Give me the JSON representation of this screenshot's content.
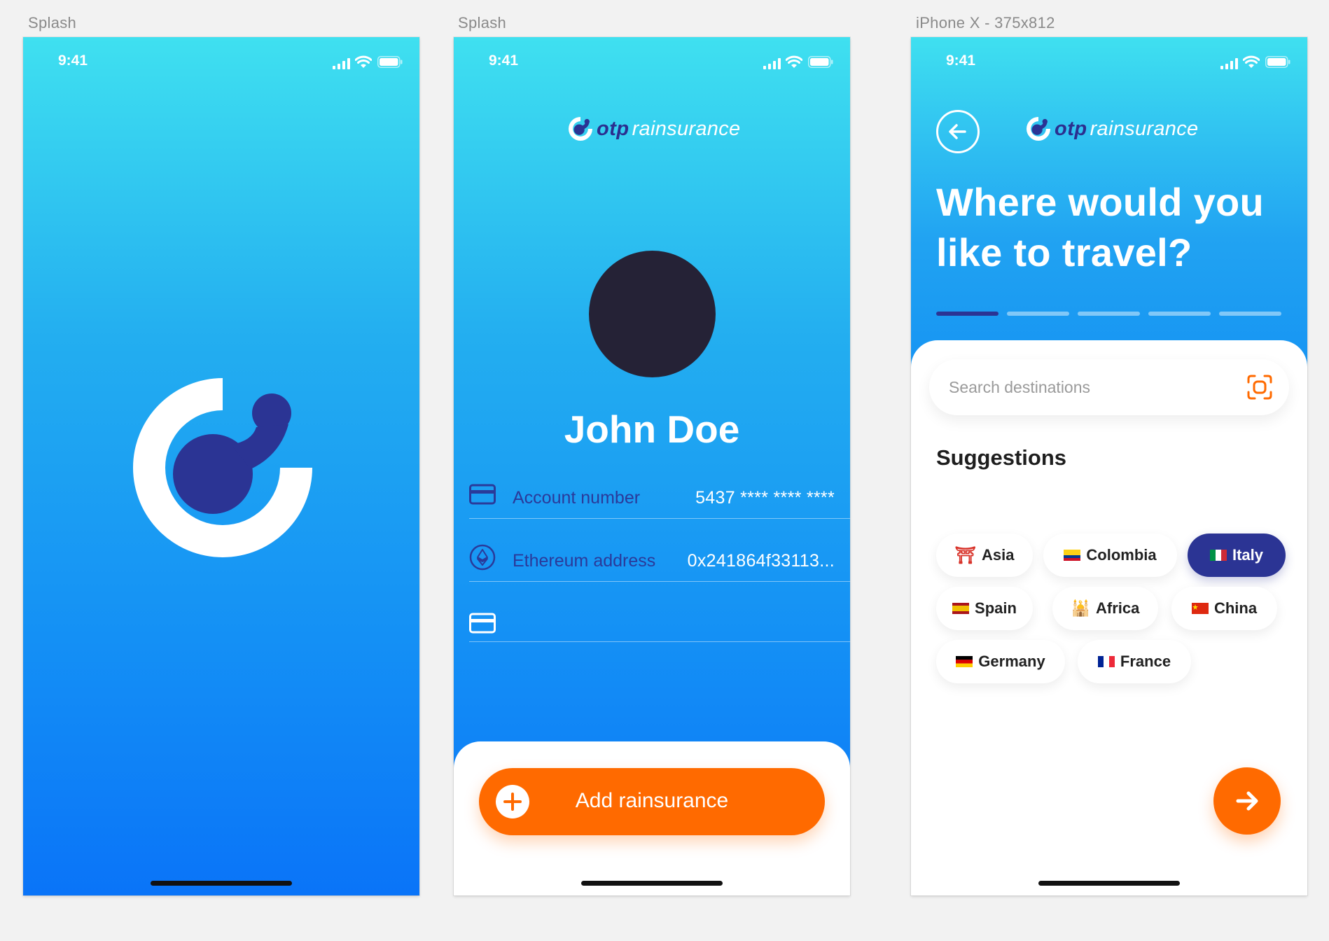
{
  "artboards": [
    {
      "label": "Splash"
    },
    {
      "label": "Splash"
    },
    {
      "label": "iPhone X - 375x812"
    }
  ],
  "status_bar": {
    "time": "9:41"
  },
  "brand": {
    "otp": "otp",
    "rain": "rainsurance"
  },
  "profile": {
    "name": "John Doe",
    "rows": [
      {
        "icon": "credit-card-icon",
        "label": "Account number",
        "value": "5437 **** **** ****"
      },
      {
        "icon": "ethereum-icon",
        "label": "Ethereum address",
        "value": "0x241864f33113..."
      },
      {
        "icon": "credit-card-icon",
        "label": "",
        "value": ""
      }
    ],
    "add_button_label": "Add rainsurance"
  },
  "travel": {
    "heading": "Where would you like to travel?",
    "progress": {
      "total_steps": 5,
      "current_step": 1
    },
    "search_placeholder": "Search destinations",
    "suggestions_title": "Suggestions",
    "chips": [
      {
        "label": "Asia",
        "flag": "⛩",
        "selected": false
      },
      {
        "label": "Colombia",
        "flag": "colombia-flag",
        "selected": false
      },
      {
        "label": "Italy",
        "flag": "italy-flag",
        "selected": true
      },
      {
        "label": "Spain",
        "flag": "spain-flag",
        "selected": false
      },
      {
        "label": "Africa",
        "flag": "🕌",
        "selected": false
      },
      {
        "label": "China",
        "flag": "china-flag",
        "selected": false
      },
      {
        "label": "Germany",
        "flag": "germany-flag",
        "selected": false
      },
      {
        "label": "France",
        "flag": "france-flag",
        "selected": false
      }
    ]
  },
  "colors": {
    "accent": "#ff6a00",
    "navy": "#2b3494",
    "gradient_top": "#3fe0f0",
    "gradient_bottom": "#0a74f8"
  }
}
